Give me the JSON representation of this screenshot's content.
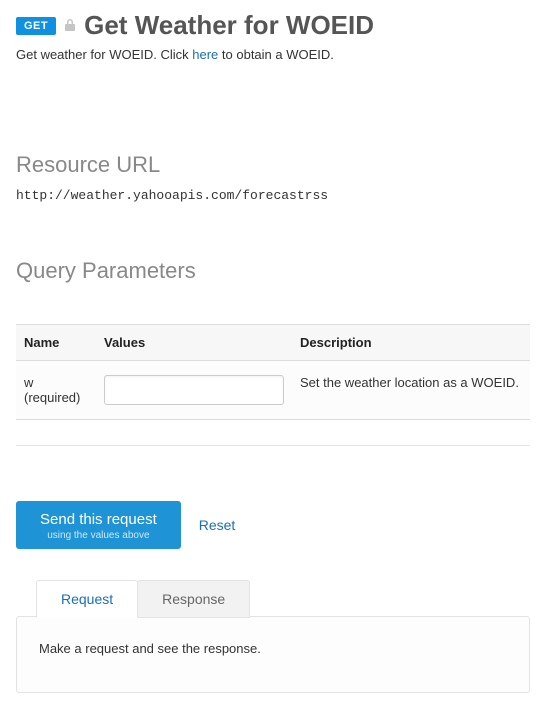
{
  "header": {
    "method": "GET",
    "title": "Get Weather for WOEID",
    "subtitle_pre": "Get weather for WOEID. Click ",
    "subtitle_link": "here",
    "subtitle_post": " to obtain a WOEID."
  },
  "resource": {
    "heading": "Resource URL",
    "url": "http://weather.yahooapis.com/forecastrss"
  },
  "query": {
    "heading": "Query Parameters",
    "columns": {
      "name": "Name",
      "values": "Values",
      "description": "Description"
    },
    "rows": [
      {
        "name": "w",
        "required": "(required)",
        "value": "",
        "description": "Set the weather location as a WOEID."
      }
    ]
  },
  "actions": {
    "send_main": "Send this request",
    "send_sub": "using the values above",
    "reset": "Reset"
  },
  "tabs": {
    "request": "Request",
    "response": "Response"
  },
  "panel": {
    "message": "Make a request and see the response."
  }
}
